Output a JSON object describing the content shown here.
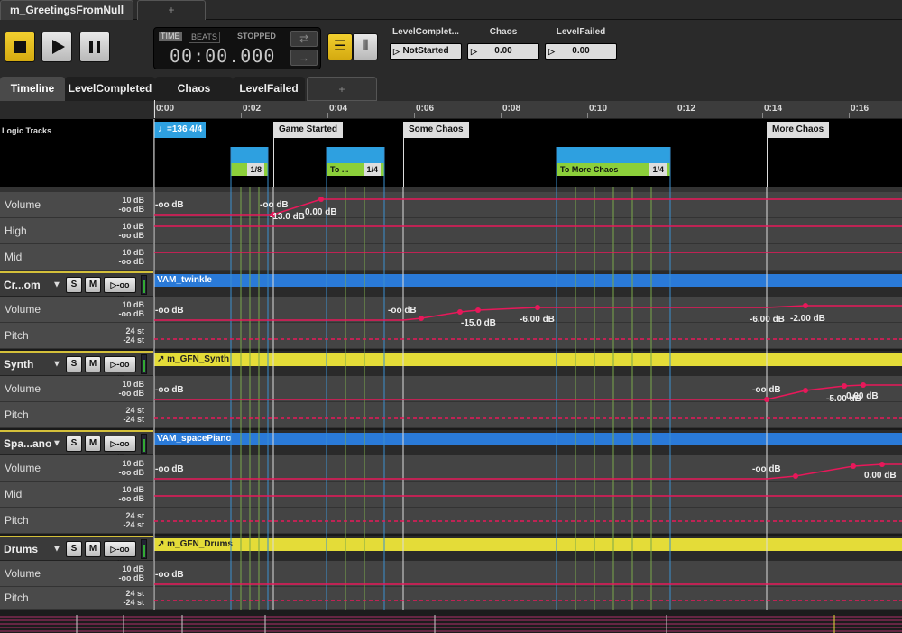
{
  "document_tab": {
    "title": "m_GreetingsFromNull",
    "add_label": "+"
  },
  "transport": {
    "time_mode": "TIME",
    "beats_mode": "BEATS",
    "state": "STOPPED",
    "time_value": "00:00.000"
  },
  "parameters": [
    {
      "name": "LevelComplet...",
      "value": "NotStarted"
    },
    {
      "name": "Chaos",
      "value": "0.00"
    },
    {
      "name": "LevelFailed",
      "value": "0.00"
    }
  ],
  "sheet_tabs": [
    {
      "label": "Timeline",
      "active": true
    },
    {
      "label": "LevelCompleted",
      "active": false
    },
    {
      "label": "Chaos",
      "active": false
    },
    {
      "label": "LevelFailed",
      "active": false
    }
  ],
  "sheet_tab_add": "+",
  "ruler": {
    "labels": [
      "0:00",
      "0:02",
      "0:04",
      "0:06",
      "0:08",
      "0:10",
      "0:12",
      "0:14",
      "0:16"
    ]
  },
  "logic": {
    "label": "Logic Tracks",
    "tempo_marker": "=136 4/4",
    "markers": [
      "Game Started",
      "Some Chaos",
      "More Chaos"
    ],
    "regions": [
      {
        "label": "",
        "count": "1/8"
      },
      {
        "label": "To ...",
        "count": "1/4"
      },
      {
        "label": "To More Chaos",
        "count": "1/4"
      }
    ]
  },
  "master_params": [
    {
      "name": "Volume",
      "max": "10 dB",
      "min": "-oo dB"
    },
    {
      "name": "High",
      "max": "10 dB",
      "min": "-oo dB"
    },
    {
      "name": "Mid",
      "max": "10 dB",
      "min": "-oo dB"
    }
  ],
  "groups": [
    {
      "name": "Cr...om",
      "instrument": "VAM_twinkle",
      "volume_label": "-oo dB",
      "params": [
        {
          "name": "Volume",
          "max": "10 dB",
          "min": "-oo dB"
        },
        {
          "name": "Pitch",
          "max": "24 st",
          "min": "-24 st"
        }
      ]
    },
    {
      "name": "Synth",
      "instrument": "m_GFN_Synth",
      "volume_label": "-oo dB",
      "params": [
        {
          "name": "Volume",
          "max": "10 dB",
          "min": "-oo dB"
        },
        {
          "name": "Pitch",
          "max": "24 st",
          "min": "-24 st"
        }
      ]
    },
    {
      "name": "Spa...ano",
      "instrument": "VAM_spacePiano",
      "volume_label": "-oo dB",
      "params": [
        {
          "name": "Volume",
          "max": "10 dB",
          "min": "-oo dB"
        },
        {
          "name": "Mid",
          "max": "10 dB",
          "min": "-oo dB"
        },
        {
          "name": "Pitch",
          "max": "24 st",
          "min": "-24 st"
        }
      ]
    },
    {
      "name": "Drums",
      "instrument": "m_GFN_Drums",
      "volume_label": "-oo dB",
      "params": [
        {
          "name": "Volume",
          "max": "10 dB",
          "min": "-oo dB"
        },
        {
          "name": "Pitch",
          "max": "24 st",
          "min": "-24 st"
        }
      ]
    }
  ],
  "buttons": {
    "solo": "S",
    "mute": "M"
  },
  "automation_labels": {
    "master_volume": [
      "-oo dB",
      "-oo dB",
      "-13.0 dB",
      "0.00 dB"
    ],
    "twinkle_volume": [
      "-oo dB",
      "-oo dB",
      "-15.0 dB",
      "-6.00 dB",
      "-6.00 dB",
      "-2.00 dB"
    ],
    "synth_volume": [
      "-oo dB",
      "-oo dB",
      "-5.00 dB",
      "0.00 dB"
    ],
    "piano_volume": [
      "-oo dB",
      "-oo dB",
      "0.00 dB"
    ],
    "drums_volume": [
      "-oo dB"
    ]
  },
  "colors": {
    "accent": "#f2cf2f",
    "automation": "#e8185a",
    "instrument_blue": "#2a7ad8",
    "instrument_yellow": "#e4dc38",
    "region_blue": "#2ea0e0",
    "region_green": "#8ccf3a"
  }
}
